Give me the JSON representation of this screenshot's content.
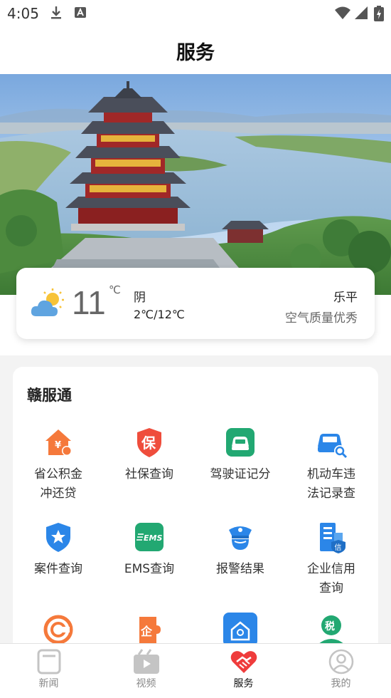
{
  "status_bar": {
    "time": "4:05"
  },
  "header": {
    "title": "服务"
  },
  "weather": {
    "temperature": "11",
    "unit": "℃",
    "condition": "阴",
    "range": "2℃/12℃",
    "city": "乐平",
    "air_quality": "空气质量优秀"
  },
  "services": {
    "title": "赣服通",
    "items": [
      {
        "label": "省公积金\n冲还贷",
        "icon": "house-fund-icon",
        "color": "#f5793b"
      },
      {
        "label": "社保查询",
        "icon": "insurance-shield-icon",
        "color": "#ef4d3c"
      },
      {
        "label": "驾驶证记分",
        "icon": "driver-license-icon",
        "color": "#22a872"
      },
      {
        "label": "机动车违\n法记录查",
        "icon": "car-search-icon",
        "color": "#2b86e8"
      },
      {
        "label": "案件查询",
        "icon": "badge-shield-icon",
        "color": "#2b86e8"
      },
      {
        "label": "EMS查询",
        "icon": "ems-icon",
        "color": "#22a872"
      },
      {
        "label": "报警结果",
        "icon": "police-cap-icon",
        "color": "#2b86e8"
      },
      {
        "label": "企业信用\n查询",
        "icon": "enterprise-credit-icon",
        "color": "#2b86e8"
      },
      {
        "label": "",
        "icon": "credit-coin-icon",
        "color": "#f5793b"
      },
      {
        "label": "",
        "icon": "enterprise-puzzle-icon",
        "color": "#f5793b"
      },
      {
        "label": "",
        "icon": "house-search-icon",
        "color": "#2b86e8"
      },
      {
        "label": "",
        "icon": "tax-person-icon",
        "color": "#22a872"
      }
    ]
  },
  "tabs": [
    {
      "label": "新闻",
      "icon": "news-icon",
      "active": false
    },
    {
      "label": "视频",
      "icon": "video-icon",
      "active": false
    },
    {
      "label": "服务",
      "icon": "handshake-heart-icon",
      "active": true
    },
    {
      "label": "我的",
      "icon": "profile-icon",
      "active": false
    }
  ]
}
